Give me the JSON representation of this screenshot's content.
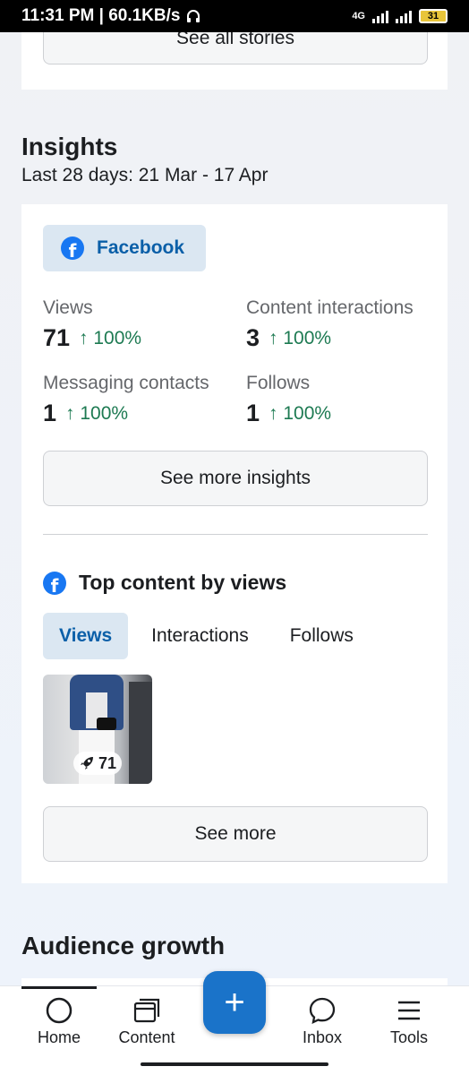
{
  "status_bar": {
    "time_speed": "11:31 PM | 60.1KB/s",
    "network": "4G",
    "battery": "31"
  },
  "stories": {
    "see_all_label": "See all stories"
  },
  "insights": {
    "title": "Insights",
    "date_range": "Last 28 days: 21 Mar - 17 Apr",
    "platform_label": "Facebook",
    "metrics": [
      {
        "label": "Views",
        "value": "71",
        "delta": "↑ 100%"
      },
      {
        "label": "Content interactions",
        "value": "3",
        "delta": "↑ 100%"
      },
      {
        "label": "Messaging contacts",
        "value": "1",
        "delta": "↑ 100%"
      },
      {
        "label": "Follows",
        "value": "1",
        "delta": "↑ 100%"
      }
    ],
    "see_more_insights_label": "See more insights"
  },
  "top_content": {
    "title": "Top content by views",
    "tabs": [
      {
        "label": "Views",
        "active": true
      },
      {
        "label": "Interactions",
        "active": false
      },
      {
        "label": "Follows",
        "active": false
      }
    ],
    "items": [
      {
        "views": "71"
      }
    ],
    "see_more_label": "See more"
  },
  "audience": {
    "title": "Audience growth"
  },
  "nav": {
    "items": [
      {
        "label": "Home",
        "icon": "home-icon"
      },
      {
        "label": "Content",
        "icon": "content-icon"
      },
      {
        "label": "Inbox",
        "icon": "inbox-icon"
      },
      {
        "label": "Tools",
        "icon": "tools-icon"
      }
    ],
    "fab_label": "+"
  },
  "colors": {
    "accent": "#1a73c9",
    "positive": "#1d7a52",
    "pill_bg": "#dbe7f2"
  }
}
